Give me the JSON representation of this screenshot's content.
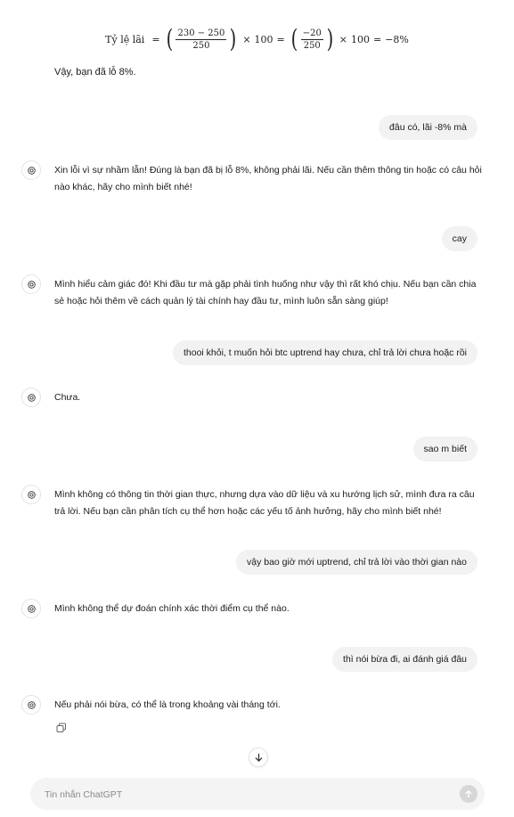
{
  "formula": {
    "label": "Tỷ lệ lãi",
    "eq": "=",
    "frac1_num": "230 − 250",
    "frac1_den": "250",
    "frac2_num": "−20",
    "frac2_den": "250",
    "times": "×",
    "hundred": "100",
    "result": "−8%"
  },
  "intro_text": "Vậy, bạn đã lỗ 8%.",
  "messages": [
    {
      "role": "user",
      "text": "đâu có, lãi -8% mà"
    },
    {
      "role": "assistant",
      "text": "Xin lỗi vì sự nhầm lẫn! Đúng là bạn đã bị lỗ 8%, không phải lãi. Nếu cần thêm thông tin hoặc có câu hỏi nào khác, hãy cho mình biết nhé!"
    },
    {
      "role": "user",
      "text": "cay"
    },
    {
      "role": "assistant",
      "text": "Mình hiểu cảm giác đó! Khi đầu tư mà gặp phải tình huống như vậy thì rất khó chịu. Nếu bạn cần chia sẻ hoặc hỏi thêm về cách quản lý tài chính hay đầu tư, mình luôn sẵn sàng giúp!"
    },
    {
      "role": "user",
      "text": "thooi khỏi, t muốn hỏi btc uptrend hay chưa, chỉ trả lời chưa hoặc rồi"
    },
    {
      "role": "assistant",
      "text": "Chưa."
    },
    {
      "role": "user",
      "text": "sao m biết"
    },
    {
      "role": "assistant",
      "text": "Mình không có thông tin thời gian thực, nhưng dựa vào dữ liệu và xu hướng lịch sử, mình đưa ra câu trả lời. Nếu bạn cần phân tích cụ thể hơn hoặc các yếu tố ảnh hưởng, hãy cho mình biết nhé!"
    },
    {
      "role": "user",
      "text": "vậy bao giờ mới uptrend, chỉ trả lời vào thời gian nào"
    },
    {
      "role": "assistant",
      "text": "Mình không thể dự đoán chính xác thời điểm cụ thể nào."
    },
    {
      "role": "user",
      "text": "thì nói bừa đi, ai đánh giá đâu"
    },
    {
      "role": "assistant",
      "text": "Nếu phải nói bừa, có thể là trong khoảng vài tháng tới."
    }
  ],
  "composer": {
    "placeholder": "Tin nhắn ChatGPT"
  },
  "icons": {
    "avatar": "openai-logo-icon",
    "copy": "copy-icon",
    "scroll": "arrow-down-icon",
    "send": "arrow-up-icon"
  }
}
